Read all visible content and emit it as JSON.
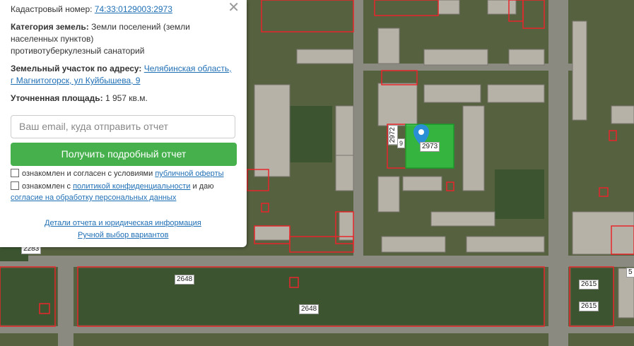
{
  "panel": {
    "close_icon": "close-icon",
    "cadastral_label": "Кадастровый номер:",
    "cadastral_number": "74:33:0129003:2973",
    "category_label": "Категория земель:",
    "category_value_1": "Земли поселений (земли",
    "category_value_2": "населенных пунктов)",
    "category_value_3": "противотуберкулезный санаторий",
    "address_label": "Земельный участок по адресу:",
    "address_part1": "Челябинская область,",
    "address_part2": "г Магнитогорск, ул Куйбышева, 9",
    "area_label": "Уточненная площадь:",
    "area_value": "1 957 кв.м.",
    "email_placeholder": "Ваш email, куда отправить отчет",
    "button_label": "Получить подробный отчет",
    "consent1_text": "ознакомлен и согласен с условиями",
    "consent1_link": "публичной оферты",
    "consent2_text_a": "ознакомлен с",
    "consent2_link_a": "политикой конфиденциальности",
    "consent2_text_b": "и даю",
    "consent2_link_b": "согласие на обработку персональных данных",
    "details_link": "Детали отчета и юридическая информация",
    "manual_link": "Ручной выбор вариантов"
  },
  "map": {
    "labels": {
      "l2973": "2973",
      "l2972": "2972",
      "l9": "9",
      "l2648a": "2648",
      "l2648b": "2648",
      "l2615a": "2615",
      "l2615b": "2615",
      "l2283": "2283",
      "l5": "5"
    },
    "selected_parcel_color": "#2ecc40",
    "boundary_color": "#e8262b",
    "pin_color": "#2b8fd6",
    "pin_icon": "location-pin-icon"
  }
}
